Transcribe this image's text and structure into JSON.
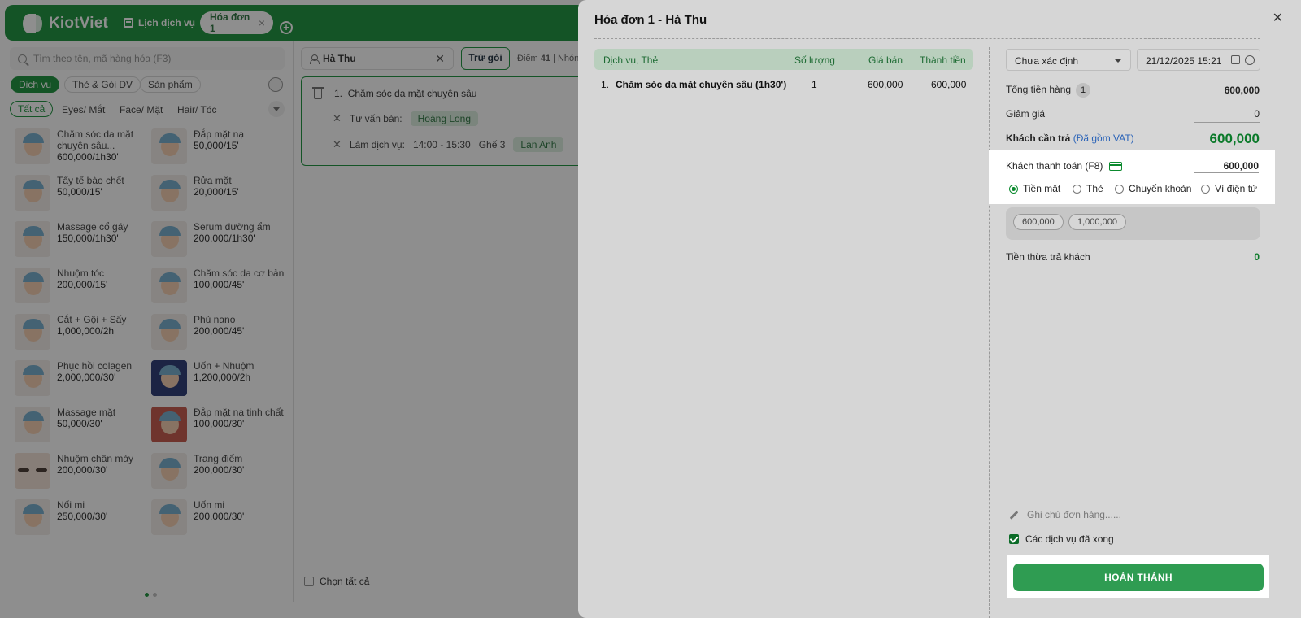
{
  "app": {
    "logo": "KiotViet",
    "tabs": [
      {
        "label": "Lịch dịch vụ"
      },
      {
        "label": "Hóa đơn 1"
      }
    ]
  },
  "search": {
    "placeholder": "Tìm theo tên, mã hàng hóa (F3)"
  },
  "categories": [
    "Dịch vụ",
    "Thẻ & Gói DV",
    "Sản phẩm"
  ],
  "filters": [
    "Tất cả",
    "Eyes/ Mắt",
    "Face/ Mặt",
    "Hair/ Tóc"
  ],
  "products": [
    {
      "name": "Chăm sóc da mặt chuyên sâu...",
      "price": "600,000/1h30'",
      "icon": "facial-thumb"
    },
    {
      "name": "Đắp mặt nạ",
      "price": "50,000/15'",
      "icon": "mask-thumb"
    },
    {
      "name": "Tẩy tế bào chết",
      "price": "50,000/15'",
      "icon": "scrub-thumb"
    },
    {
      "name": "Rửa mặt",
      "price": "20,000/15'",
      "icon": "wash-thumb"
    },
    {
      "name": "Massage cổ gáy",
      "price": "150,000/1h30'",
      "icon": "massage-thumb"
    },
    {
      "name": "Serum dưỡng ẩm",
      "price": "200,000/1h30'",
      "icon": "serum-thumb"
    },
    {
      "name": "Nhuộm tóc",
      "price": "200,000/15'",
      "icon": "dye-thumb"
    },
    {
      "name": "Chăm sóc da cơ bản",
      "price": "100,000/45'",
      "icon": "basic-care-thumb"
    },
    {
      "name": "Cắt + Gội + Sấy",
      "price": "1,000,000/2h",
      "icon": "haircut-thumb"
    },
    {
      "name": "Phủ nano",
      "price": "200,000/45'",
      "icon": "nano-thumb"
    },
    {
      "name": "Phục hồi colagen",
      "price": "2,000,000/30'",
      "icon": "collagen-thumb"
    },
    {
      "name": "Uốn + Nhuộm",
      "price": "1,200,000/2h",
      "icon": "perm-dye-thumb"
    },
    {
      "name": "Massage mặt",
      "price": "50,000/30'",
      "icon": "face-massage-thumb"
    },
    {
      "name": "Đắp mặt nạ tinh chất",
      "price": "100,000/30'",
      "icon": "essence-mask-thumb"
    },
    {
      "name": "Nhuộm chân mày",
      "price": "200,000/30'",
      "icon": "brow-thumb"
    },
    {
      "name": "Trang điểm",
      "price": "200,000/30'",
      "icon": "makeup-thumb"
    },
    {
      "name": "Nối mi",
      "price": "250,000/30'",
      "icon": "lash-thumb"
    },
    {
      "name": "Uốn mi",
      "price": "200,000/30'",
      "icon": "lash-curl-thumb"
    }
  ],
  "customer": {
    "name": "Hà Thu",
    "tru_goi": "Trừ gói",
    "points_label": "Điểm",
    "points": "41",
    "group": "Nhón"
  },
  "cart_item": {
    "index": "1.",
    "name": "Chăm sóc da mặt chuyên sâu",
    "consultant_label": "Tư vấn bán:",
    "consultant": "Hoàng Long",
    "service_label": "Làm dịch vụ:",
    "time": "14:00 - 15:30",
    "chair": "Ghế 3",
    "staff": "Lan Anh"
  },
  "select_all": "Chọn tất cả",
  "modal": {
    "title": "Hóa đơn 1 - Hà Thu",
    "table": {
      "headers": [
        "Dịch vụ, Thẻ",
        "Số lượng",
        "Giá bán",
        "Thành tiền"
      ],
      "rows": [
        {
          "index": "1.",
          "name": "Chăm sóc da mặt chuyên sâu (1h30')",
          "qty": "1",
          "price": "600,000",
          "total": "600,000"
        }
      ]
    },
    "price_list": "Chưa xác định",
    "datetime": "21/12/2025 15:21",
    "summary": {
      "subtotal_label": "Tổng tiền hàng",
      "subtotal_count": "1",
      "subtotal": "600,000",
      "discount_label": "Giảm giá",
      "discount": "0",
      "due_label": "Khách cần trả",
      "due_vat": "(Đã gồm VAT)",
      "due": "600,000"
    },
    "payment": {
      "label": "Khách thanh toán (F8)",
      "value": "600,000",
      "methods": [
        "Tiền mặt",
        "Thẻ",
        "Chuyển khoản",
        "Ví điện tử"
      ],
      "selected": "Tiền mặt",
      "quick": [
        "600,000",
        "1,000,000"
      ]
    },
    "change_label": "Tiền thừa trả khách",
    "change": "0",
    "note_placeholder": "Ghi chú đơn hàng......",
    "done_services": "Các dịch vụ đã xong",
    "submit": "HOÀN THÀNH"
  },
  "colors": {
    "brand": "#0b8a2e",
    "accent_button": "#2f9c52",
    "vat_link": "#2a63b8"
  }
}
